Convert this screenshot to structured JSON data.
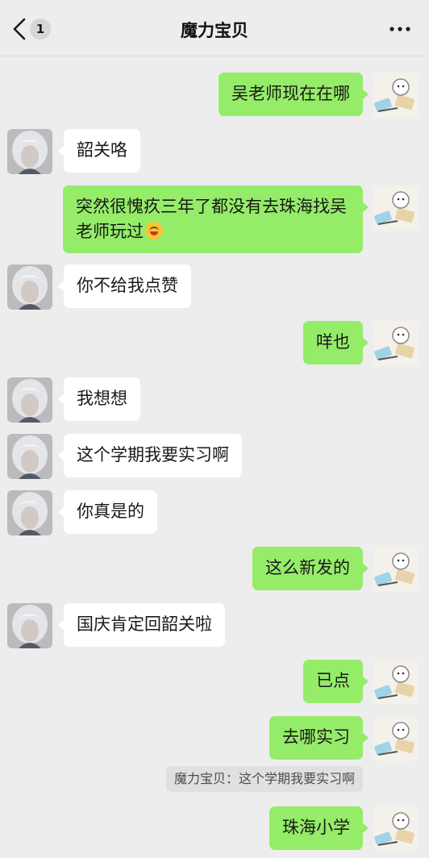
{
  "nav": {
    "back_icon": "chevron-left-icon",
    "unread_count": "1",
    "title": "魔力宝贝",
    "more_icon": "more-icon"
  },
  "colors": {
    "background": "#ededed",
    "outgoing_bubble": "#95ec69",
    "incoming_bubble": "#ffffff",
    "quote_background": "#e0e0e0"
  },
  "messages": [
    {
      "side": "out",
      "text": "吴老师现在在哪"
    },
    {
      "side": "in",
      "text": "韶关咯"
    },
    {
      "side": "out",
      "text": "突然很愧疚三年了都没有去珠海找吴老师玩过",
      "emoji": "grinning-face-emoji"
    },
    {
      "side": "in",
      "text": "你不给我点赞"
    },
    {
      "side": "out",
      "text": "咩也"
    },
    {
      "side": "in",
      "text": "我想想"
    },
    {
      "side": "in",
      "text": "这个学期我要实习啊"
    },
    {
      "side": "in",
      "text": "你真是的"
    },
    {
      "side": "out",
      "text": "这么新发的"
    },
    {
      "side": "in",
      "text": "国庆肯定回韶关啦"
    },
    {
      "side": "out",
      "text": "已点"
    },
    {
      "side": "out",
      "text": "去哪实习"
    },
    {
      "side": "out",
      "text": "珠海小学"
    }
  ],
  "quote": {
    "text": "魔力宝贝：这个学期我要实习啊"
  }
}
